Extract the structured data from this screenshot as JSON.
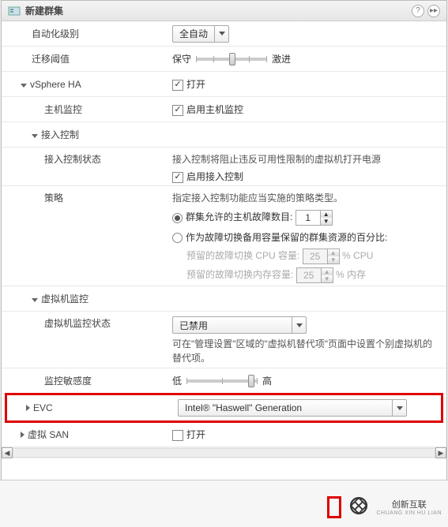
{
  "window": {
    "title": "新建群集",
    "help_icon": "?",
    "pin_icon": "▸▸"
  },
  "rows": {
    "automation_level": {
      "label": "自动化级别",
      "value": "全自动"
    },
    "migration_threshold": {
      "label": "迁移阈值",
      "left": "保守",
      "right": "激进"
    },
    "vsphere_ha": {
      "label": "vSphere HA",
      "checkbox_label": "打开"
    },
    "host_monitoring": {
      "label": "主机监控",
      "checkbox_label": "启用主机监控"
    },
    "admission_control": {
      "label": "接入控制"
    },
    "admission_status": {
      "label": "接入控制状态",
      "desc": "接入控制将阻止违反可用性限制的虚拟机打开电源",
      "checkbox_label": "启用接入控制"
    },
    "policy": {
      "label": "策略",
      "desc": "指定接入控制功能应当实施的策略类型。",
      "radio1_label": "群集允许的主机故障数目:",
      "radio1_value": "1",
      "radio2_label": "作为故障切换备用容量保留的群集资源的百分比:",
      "cpu_label": "预留的故障切换 CPU 容量:",
      "cpu_val": "25",
      "cpu_unit": "%  CPU",
      "mem_label": "预留的故障切换内存容量:",
      "mem_val": "25",
      "mem_unit": "%  内存"
    },
    "vm_monitoring": {
      "label": "虚拟机监控"
    },
    "vm_monitoring_status": {
      "label": "虚拟机监控状态",
      "value": "已禁用",
      "desc": "可在\"管理设置\"区域的\"虚拟机替代项\"页面中设置个别虚拟机的替代项。"
    },
    "monitoring_sensitivity": {
      "label": "监控敏感度",
      "left": "低",
      "right": "高"
    },
    "evc": {
      "label": "EVC",
      "value": "Intel® \"Haswell\" Generation"
    },
    "vsan": {
      "label": "虚拟 SAN",
      "checkbox_label": "打开"
    }
  },
  "footer": {
    "brand": "创新互联",
    "brand_sub": "CHUANG XIN HU LIAN"
  }
}
